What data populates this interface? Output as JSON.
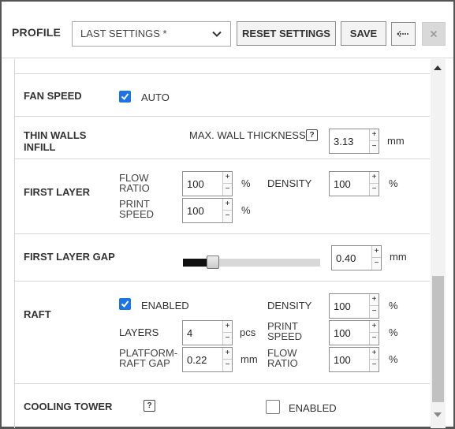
{
  "header": {
    "profile_label": "PROFILE",
    "profile_selected": "LAST SETTINGS *",
    "reset_label": "RESET SETTINGS",
    "save_label": "SAVE",
    "back_icon": "back-arrow-icon",
    "close_icon": "close-icon"
  },
  "fan_speed": {
    "title": "FAN SPEED",
    "auto_label": "AUTO",
    "auto_checked": true
  },
  "thin_walls": {
    "title_line1": "THIN WALLS",
    "title_line2": "INFILL",
    "max_label": "MAX. WALL THICKNESS",
    "help": "?",
    "value": "3.13",
    "unit": "mm"
  },
  "first_layer": {
    "title": "FIRST LAYER",
    "flow_label1": "FLOW",
    "flow_label2": "RATIO",
    "flow_value": "100",
    "flow_unit": "%",
    "print_label1": "PRINT",
    "print_label2": "SPEED",
    "print_value": "100",
    "print_unit": "%",
    "density_label": "DENSITY",
    "density_value": "100",
    "density_unit": "%"
  },
  "first_layer_gap": {
    "title": "FIRST LAYER GAP",
    "value": "0.40",
    "unit": "mm",
    "slider_fraction": 0.22
  },
  "raft": {
    "title": "RAFT",
    "enabled_label": "ENABLED",
    "enabled_checked": true,
    "layers_label": "LAYERS",
    "layers_value": "4",
    "layers_unit": "pcs",
    "gap_label1": "PLATFORM-",
    "gap_label2": "RAFT GAP",
    "gap_value": "0.22",
    "gap_unit": "mm",
    "density_label": "DENSITY",
    "density_value": "100",
    "density_unit": "%",
    "print_label1": "PRINT",
    "print_label2": "SPEED",
    "print_value": "100",
    "print_unit": "%",
    "flow_label1": "FLOW",
    "flow_label2": "RATIO",
    "flow_value": "100",
    "flow_unit": "%"
  },
  "cooling_tower": {
    "title": "COOLING TOWER",
    "help": "?",
    "enabled_label": "ENABLED",
    "enabled_checked": false
  },
  "spinner": {
    "up": "+",
    "down": "−"
  },
  "colors": {
    "accent": "#1a73e8",
    "border": "#555555"
  }
}
